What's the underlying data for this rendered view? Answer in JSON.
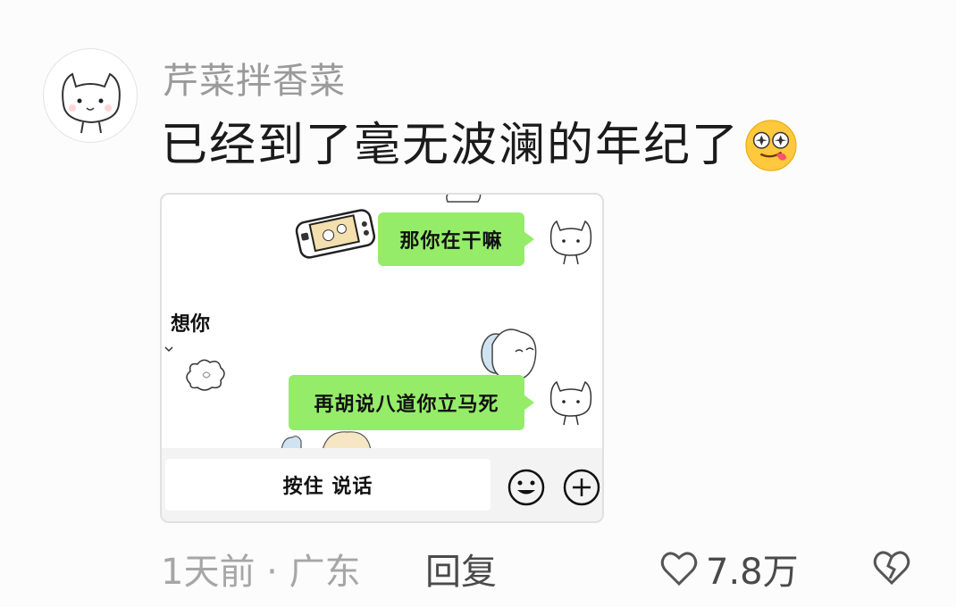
{
  "comment": {
    "username": "芹菜拌香菜",
    "text": "已经到了毫无波澜的年纪了",
    "emoji": "starstruck-tongue-emoji-icon"
  },
  "screenshot": {
    "messages": [
      {
        "side": "right",
        "text": "那你在干嘛"
      },
      {
        "side": "left",
        "text": "想你"
      },
      {
        "side": "right",
        "text": "再胡说八道你立马死"
      }
    ],
    "input_bar": {
      "hold_to_talk": "按住 说话",
      "emoji_icon": "smiley-icon",
      "plus_icon": "plus-circle-icon"
    }
  },
  "footer": {
    "time_location": "1天前 · 广东",
    "reply": "回复",
    "likes": "7.8万",
    "like_icon": "heart-outline-icon",
    "dislike_icon": "broken-heart-icon"
  },
  "colors": {
    "bubble_green": "#95ec69",
    "username_gray": "#9a9a9a",
    "text_dark": "#1b1b1b"
  }
}
